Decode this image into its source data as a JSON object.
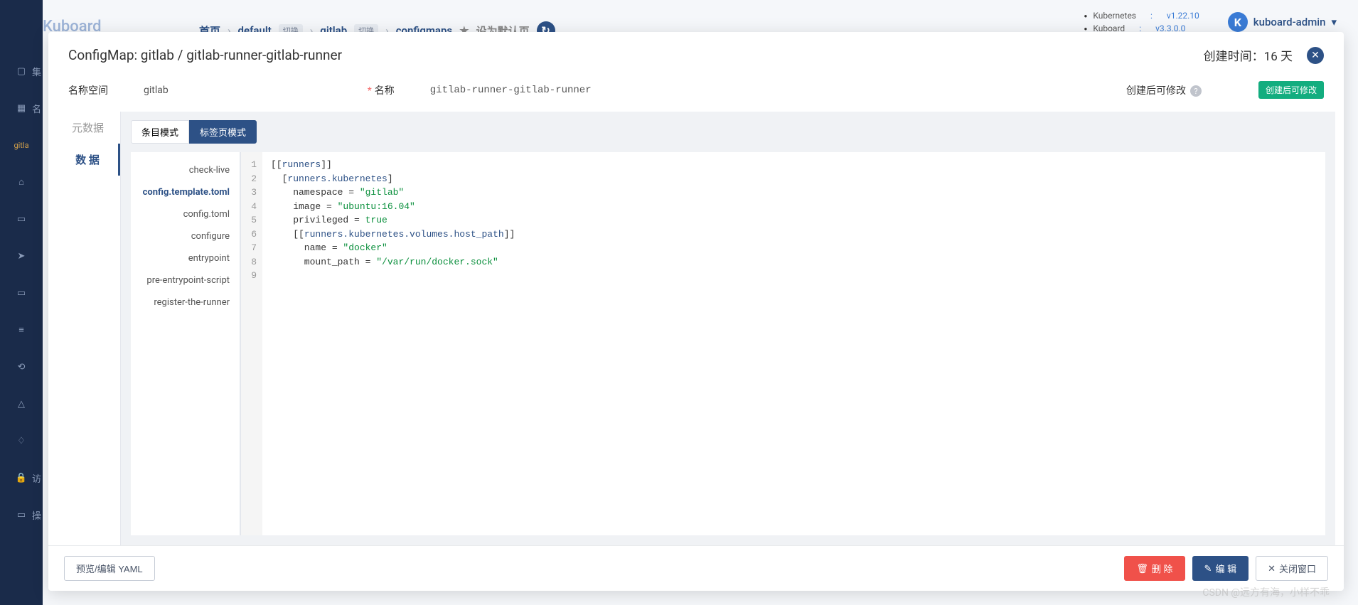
{
  "app": {
    "name": "Kuboard"
  },
  "breadcrumb": {
    "home": "首页",
    "ns": "default",
    "tag1": "切换",
    "app": "gitlab",
    "tag2": "切换",
    "res": "configmaps",
    "setDefault": "设为默认页"
  },
  "versions": {
    "k8s_label": "Kubernetes",
    "k8s_val": "v1.22.10",
    "kuboard_label": "Kuboard",
    "kuboard_val": "v3.3.0.0"
  },
  "user": "kuboard-admin",
  "sidebar": {
    "items": [
      "集",
      "名",
      "gitla",
      "",
      "",
      "",
      "",
      "",
      "",
      "",
      "访",
      "操"
    ]
  },
  "modal": {
    "title": "ConfigMap: gitlab / gitlab-runner-gitlab-runner",
    "created_label": "创建时间：",
    "created_value": "16 天",
    "form": {
      "ns_label": "名称空间",
      "ns_value": "gitlab",
      "name_label": "名称",
      "name_value": "gitlab-runner-gitlab-runner",
      "editable_label": "创建后可修改",
      "editable_badge": "创建后可修改"
    },
    "leftTabs": {
      "meta": "元数据",
      "data": "数 据"
    },
    "modeTabs": {
      "entry": "条目模式",
      "tab": "标签页模式"
    },
    "keys": [
      "check-live",
      "config.template.toml",
      "config.toml",
      "configure",
      "entrypoint",
      "pre-entrypoint-script",
      "register-the-runner"
    ],
    "activeKey": "config.template.toml",
    "footer": {
      "yaml": "预览/编辑 YAML",
      "delete": "删 除",
      "edit": "编 辑",
      "close": "关闭窗口"
    }
  },
  "code": {
    "lines": 9
  },
  "watermark": "CSDN @远方有海，小样不乖"
}
